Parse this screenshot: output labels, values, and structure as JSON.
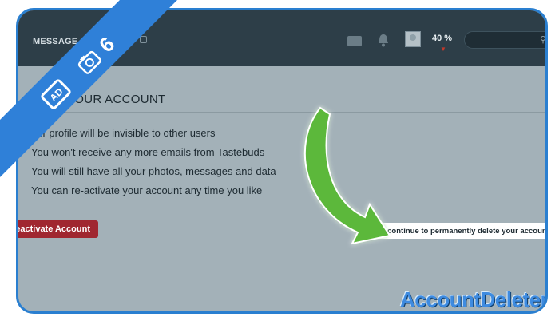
{
  "app": {
    "title": "MESSAGE BOMB",
    "progress": "40 %",
    "progress_indicator": "▼",
    "search_glyph": "⚲"
  },
  "page": {
    "heading_visible": "YOUR ACCOUNT",
    "info_items": [
      "our profile will be invisible to other users",
      "You won't receive any more emails from Tastebuds",
      "You will still have all your photos, messages and data",
      "You can re-activate your account any time you like"
    ],
    "deactivate_label": "eactivate Account",
    "delete_link": "or continue to permanently delete your account"
  },
  "overlay": {
    "step_number": "6",
    "logo": {
      "part1": "Account",
      "part2": "Deleters"
    },
    "colors": {
      "banner_blue": "#2f80d8",
      "arrow_green": "#5cb83a",
      "frame": "#2a7fd0",
      "deactivate_red": "#a02730"
    }
  }
}
